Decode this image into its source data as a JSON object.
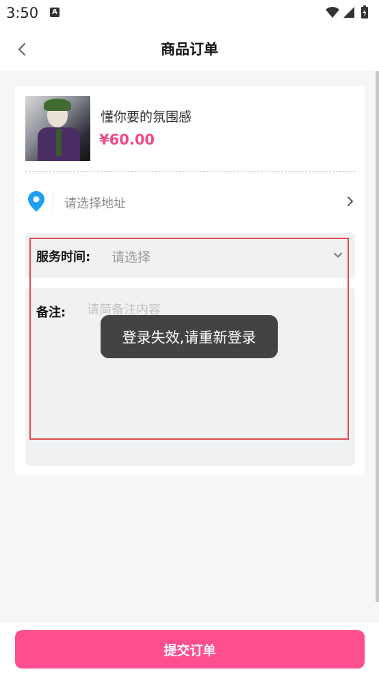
{
  "status_bar": {
    "time": "3:50",
    "app_icon_letter": "A",
    "icons": [
      "wifi-icon",
      "signal-icon",
      "battery-charging-icon"
    ]
  },
  "nav": {
    "back_icon": "chevron-left-icon",
    "title": "商品订单"
  },
  "product": {
    "name": "懂你要的氛围感",
    "price": "¥60.00",
    "image": "joker-character-thumbnail"
  },
  "address": {
    "icon": "location-pin-icon",
    "placeholder": "请选择地址"
  },
  "service_time": {
    "label": "服务时间:",
    "placeholder": "请选择"
  },
  "remark": {
    "label": "备注:",
    "placeholder": "请简备注内容"
  },
  "toast": {
    "message": "登录失效,请重新登录"
  },
  "footer": {
    "submit_label": "提交订单"
  },
  "colors": {
    "accent": "#ff4e8f",
    "price": "#f0488b",
    "location_pin": "#1ea0f2",
    "highlight_border": "#e04a4a"
  }
}
